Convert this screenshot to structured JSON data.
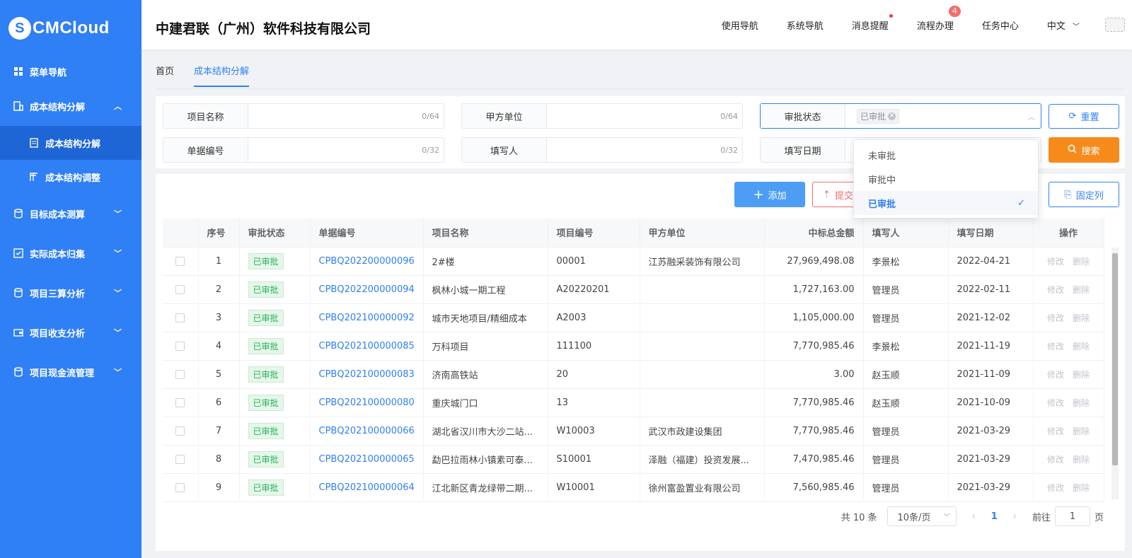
{
  "brand": {
    "logo_mark": "S",
    "logo_text": "CMCloud"
  },
  "sidebar": {
    "items": [
      {
        "label": "菜单导航"
      },
      {
        "label": "成本结构分解"
      },
      {
        "label": "成本结构分解"
      },
      {
        "label": "成本结构调整"
      },
      {
        "label": "目标成本测算"
      },
      {
        "label": "实际成本归集"
      },
      {
        "label": "项目三算分析"
      },
      {
        "label": "项目收支分析"
      },
      {
        "label": "项目现金流管理"
      }
    ]
  },
  "header": {
    "company": "中建君联（广州）软件科技有限公司",
    "nav": [
      "使用导航",
      "系统导航",
      "消息提醒",
      "流程办理",
      "任务中心",
      "中文"
    ],
    "workflow_badge": "4"
  },
  "tabs": [
    "首页",
    "成本结构分解"
  ],
  "filters": {
    "project_name": {
      "label": "项目名称",
      "counter": "0/64"
    },
    "party_a": {
      "label": "甲方单位",
      "counter": "0/64"
    },
    "status": {
      "label": "审批状态",
      "tag": "已审批"
    },
    "doc_no": {
      "label": "单据编号",
      "counter": "0/32"
    },
    "filler": {
      "label": "填写人",
      "counter": "0/32"
    },
    "fill_date": {
      "label": "填写日期"
    }
  },
  "buttons": {
    "reset": "重置",
    "search": "搜索",
    "add": "添加",
    "submit": "提交",
    "fixed_cols": "固定列"
  },
  "status_dropdown": {
    "options": [
      "未审批",
      "审批中",
      "已审批"
    ],
    "selected": "已审批"
  },
  "table": {
    "headers": [
      "序号",
      "审批状态",
      "单据编号",
      "项目名称",
      "项目编号",
      "甲方单位",
      "中标总金额",
      "填写人",
      "填写日期",
      "操作"
    ],
    "rows": [
      {
        "no": "1",
        "status": "已审批",
        "code": "CPBQ202200000096",
        "name": "2#楼",
        "pno": "00001",
        "party": "江苏融采装饰有限公司",
        "amount": "27,969,498.08",
        "filler": "李景松",
        "date": "2022-04-21"
      },
      {
        "no": "2",
        "status": "已审批",
        "code": "CPBQ202200000094",
        "name": "枫林小城一期工程",
        "pno": "A20220201",
        "party": "",
        "amount": "1,727,163.00",
        "filler": "管理员",
        "date": "2022-02-11"
      },
      {
        "no": "3",
        "status": "已审批",
        "code": "CPBQ202100000092",
        "name": "城市天地项目/精细成本",
        "pno": "A2003",
        "party": "",
        "amount": "1,105,000.00",
        "filler": "管理员",
        "date": "2021-12-02"
      },
      {
        "no": "4",
        "status": "已审批",
        "code": "CPBQ202100000085",
        "name": "万科项目",
        "pno": "111100",
        "party": "",
        "amount": "7,770,985.46",
        "filler": "李景松",
        "date": "2021-11-19"
      },
      {
        "no": "5",
        "status": "已审批",
        "code": "CPBQ202100000083",
        "name": "济南高铁站",
        "pno": "20",
        "party": "",
        "amount": "3.00",
        "filler": "赵玉顺",
        "date": "2021-11-09"
      },
      {
        "no": "6",
        "status": "已审批",
        "code": "CPBQ202100000080",
        "name": "重庆城门口",
        "pno": "13",
        "party": "",
        "amount": "7,770,985.46",
        "filler": "赵玉顺",
        "date": "2021-10-09"
      },
      {
        "no": "7",
        "status": "已审批",
        "code": "CPBQ202100000066",
        "name": "湖北省汉川市大沙二站...",
        "pno": "W10003",
        "party": "武汉市政建设集团",
        "amount": "7,770,985.46",
        "filler": "管理员",
        "date": "2021-03-29"
      },
      {
        "no": "8",
        "status": "已审批",
        "code": "CPBQ202100000065",
        "name": "勐巴拉雨林小镇素可泰...",
        "pno": "S10001",
        "party": "泽融（福建）投资发展...",
        "amount": "7,470,985.46",
        "filler": "管理员",
        "date": "2021-03-29"
      },
      {
        "no": "9",
        "status": "已审批",
        "code": "CPBQ202100000064",
        "name": "江北新区青龙绿带二期...",
        "pno": "W10001",
        "party": "徐州富盈置业有限公司",
        "amount": "7,560,985.46",
        "filler": "管理员",
        "date": "2021-03-29"
      }
    ],
    "actions": {
      "edit": "修改",
      "delete": "删除"
    }
  },
  "pagination": {
    "total": "共 10 条",
    "page_size": "10条/页",
    "current": "1",
    "goto_label": "前往",
    "goto_value": "1",
    "page_suffix": "页"
  },
  "colors": {
    "primary": "#2f7ff5",
    "sidebar": "#2f7ff5",
    "search": "#f68a1b",
    "approved": "#26b05b"
  }
}
